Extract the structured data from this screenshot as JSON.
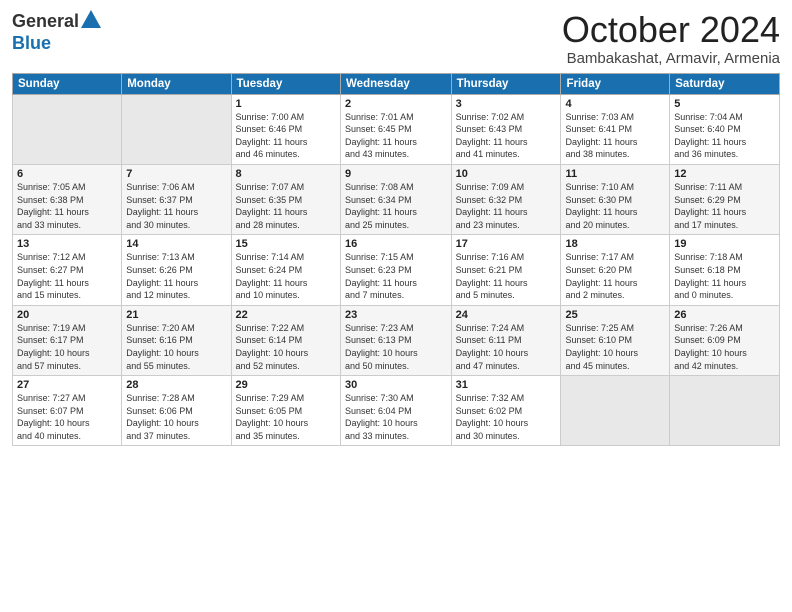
{
  "header": {
    "logo_general": "General",
    "logo_blue": "Blue",
    "month": "October 2024",
    "location": "Bambakashat, Armavir, Armenia"
  },
  "weekdays": [
    "Sunday",
    "Monday",
    "Tuesday",
    "Wednesday",
    "Thursday",
    "Friday",
    "Saturday"
  ],
  "weeks": [
    [
      {
        "day": "",
        "info": ""
      },
      {
        "day": "",
        "info": ""
      },
      {
        "day": "1",
        "info": "Sunrise: 7:00 AM\nSunset: 6:46 PM\nDaylight: 11 hours\nand 46 minutes."
      },
      {
        "day": "2",
        "info": "Sunrise: 7:01 AM\nSunset: 6:45 PM\nDaylight: 11 hours\nand 43 minutes."
      },
      {
        "day": "3",
        "info": "Sunrise: 7:02 AM\nSunset: 6:43 PM\nDaylight: 11 hours\nand 41 minutes."
      },
      {
        "day": "4",
        "info": "Sunrise: 7:03 AM\nSunset: 6:41 PM\nDaylight: 11 hours\nand 38 minutes."
      },
      {
        "day": "5",
        "info": "Sunrise: 7:04 AM\nSunset: 6:40 PM\nDaylight: 11 hours\nand 36 minutes."
      }
    ],
    [
      {
        "day": "6",
        "info": "Sunrise: 7:05 AM\nSunset: 6:38 PM\nDaylight: 11 hours\nand 33 minutes."
      },
      {
        "day": "7",
        "info": "Sunrise: 7:06 AM\nSunset: 6:37 PM\nDaylight: 11 hours\nand 30 minutes."
      },
      {
        "day": "8",
        "info": "Sunrise: 7:07 AM\nSunset: 6:35 PM\nDaylight: 11 hours\nand 28 minutes."
      },
      {
        "day": "9",
        "info": "Sunrise: 7:08 AM\nSunset: 6:34 PM\nDaylight: 11 hours\nand 25 minutes."
      },
      {
        "day": "10",
        "info": "Sunrise: 7:09 AM\nSunset: 6:32 PM\nDaylight: 11 hours\nand 23 minutes."
      },
      {
        "day": "11",
        "info": "Sunrise: 7:10 AM\nSunset: 6:30 PM\nDaylight: 11 hours\nand 20 minutes."
      },
      {
        "day": "12",
        "info": "Sunrise: 7:11 AM\nSunset: 6:29 PM\nDaylight: 11 hours\nand 17 minutes."
      }
    ],
    [
      {
        "day": "13",
        "info": "Sunrise: 7:12 AM\nSunset: 6:27 PM\nDaylight: 11 hours\nand 15 minutes."
      },
      {
        "day": "14",
        "info": "Sunrise: 7:13 AM\nSunset: 6:26 PM\nDaylight: 11 hours\nand 12 minutes."
      },
      {
        "day": "15",
        "info": "Sunrise: 7:14 AM\nSunset: 6:24 PM\nDaylight: 11 hours\nand 10 minutes."
      },
      {
        "day": "16",
        "info": "Sunrise: 7:15 AM\nSunset: 6:23 PM\nDaylight: 11 hours\nand 7 minutes."
      },
      {
        "day": "17",
        "info": "Sunrise: 7:16 AM\nSunset: 6:21 PM\nDaylight: 11 hours\nand 5 minutes."
      },
      {
        "day": "18",
        "info": "Sunrise: 7:17 AM\nSunset: 6:20 PM\nDaylight: 11 hours\nand 2 minutes."
      },
      {
        "day": "19",
        "info": "Sunrise: 7:18 AM\nSunset: 6:18 PM\nDaylight: 11 hours\nand 0 minutes."
      }
    ],
    [
      {
        "day": "20",
        "info": "Sunrise: 7:19 AM\nSunset: 6:17 PM\nDaylight: 10 hours\nand 57 minutes."
      },
      {
        "day": "21",
        "info": "Sunrise: 7:20 AM\nSunset: 6:16 PM\nDaylight: 10 hours\nand 55 minutes."
      },
      {
        "day": "22",
        "info": "Sunrise: 7:22 AM\nSunset: 6:14 PM\nDaylight: 10 hours\nand 52 minutes."
      },
      {
        "day": "23",
        "info": "Sunrise: 7:23 AM\nSunset: 6:13 PM\nDaylight: 10 hours\nand 50 minutes."
      },
      {
        "day": "24",
        "info": "Sunrise: 7:24 AM\nSunset: 6:11 PM\nDaylight: 10 hours\nand 47 minutes."
      },
      {
        "day": "25",
        "info": "Sunrise: 7:25 AM\nSunset: 6:10 PM\nDaylight: 10 hours\nand 45 minutes."
      },
      {
        "day": "26",
        "info": "Sunrise: 7:26 AM\nSunset: 6:09 PM\nDaylight: 10 hours\nand 42 minutes."
      }
    ],
    [
      {
        "day": "27",
        "info": "Sunrise: 7:27 AM\nSunset: 6:07 PM\nDaylight: 10 hours\nand 40 minutes."
      },
      {
        "day": "28",
        "info": "Sunrise: 7:28 AM\nSunset: 6:06 PM\nDaylight: 10 hours\nand 37 minutes."
      },
      {
        "day": "29",
        "info": "Sunrise: 7:29 AM\nSunset: 6:05 PM\nDaylight: 10 hours\nand 35 minutes."
      },
      {
        "day": "30",
        "info": "Sunrise: 7:30 AM\nSunset: 6:04 PM\nDaylight: 10 hours\nand 33 minutes."
      },
      {
        "day": "31",
        "info": "Sunrise: 7:32 AM\nSunset: 6:02 PM\nDaylight: 10 hours\nand 30 minutes."
      },
      {
        "day": "",
        "info": ""
      },
      {
        "day": "",
        "info": ""
      }
    ]
  ]
}
